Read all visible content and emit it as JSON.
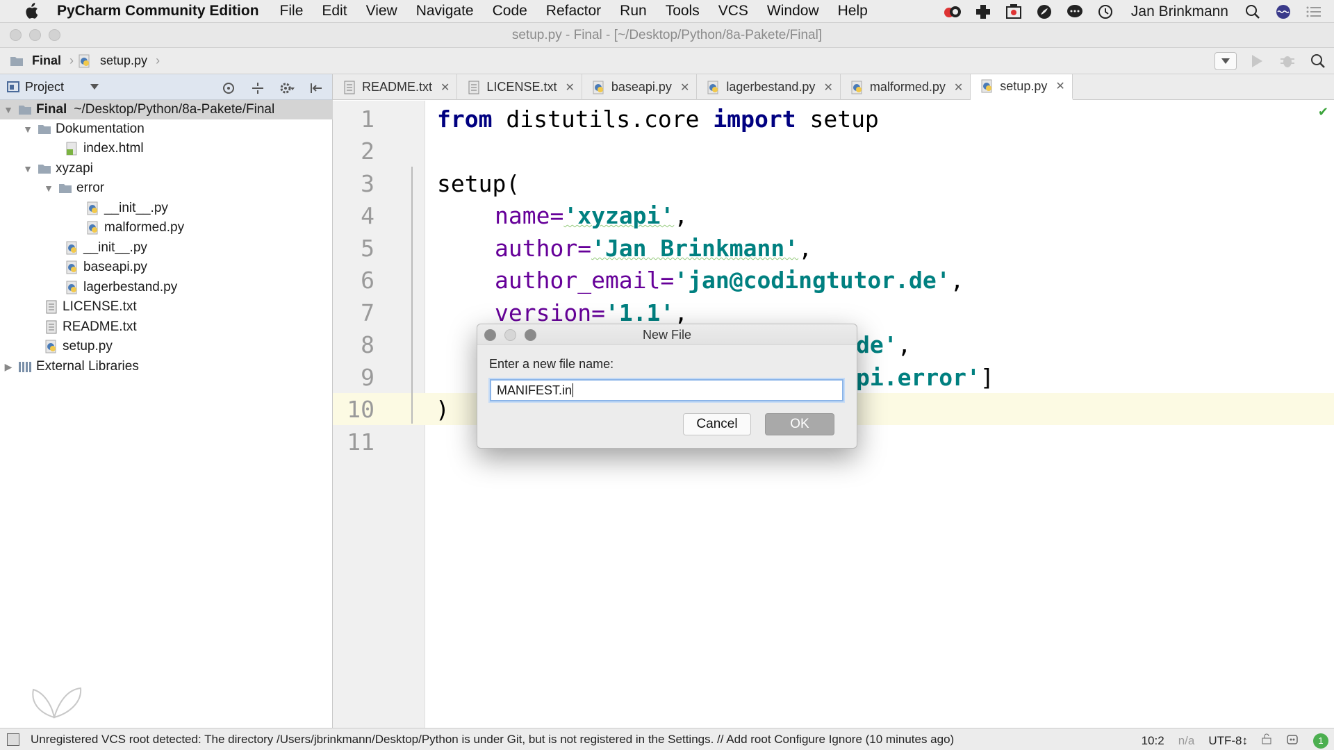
{
  "menubar": {
    "app_name": "PyCharm Community Edition",
    "items": [
      "File",
      "Edit",
      "View",
      "Navigate",
      "Code",
      "Refactor",
      "Run",
      "Tools",
      "VCS",
      "Window",
      "Help"
    ],
    "user": "Jan Brinkmann"
  },
  "window": {
    "title": "setup.py - Final - [~/Desktop/Python/8a-Pakete/Final]"
  },
  "breadcrumb": {
    "root": "Final",
    "file": "setup.py"
  },
  "project_panel": {
    "title": "Project",
    "tree": [
      {
        "name": "Final",
        "detail": "~/Desktop/Python/8a-Pakete/Final",
        "type": "folder"
      },
      {
        "name": "Dokumentation",
        "type": "folder"
      },
      {
        "name": "index.html",
        "type": "html"
      },
      {
        "name": "xyzapi",
        "type": "folder"
      },
      {
        "name": "error",
        "type": "folder"
      },
      {
        "name": "__init__.py",
        "type": "py"
      },
      {
        "name": "malformed.py",
        "type": "py"
      },
      {
        "name": "__init__.py",
        "type": "py"
      },
      {
        "name": "baseapi.py",
        "type": "py"
      },
      {
        "name": "lagerbestand.py",
        "type": "py"
      },
      {
        "name": "LICENSE.txt",
        "type": "txt"
      },
      {
        "name": "README.txt",
        "type": "txt"
      },
      {
        "name": "setup.py",
        "type": "py"
      },
      {
        "name": "External Libraries",
        "type": "lib"
      }
    ]
  },
  "tabs": [
    {
      "label": "README.txt",
      "type": "txt"
    },
    {
      "label": "LICENSE.txt",
      "type": "txt"
    },
    {
      "label": "baseapi.py",
      "type": "py"
    },
    {
      "label": "lagerbestand.py",
      "type": "py"
    },
    {
      "label": "malformed.py",
      "type": "py"
    },
    {
      "label": "setup.py",
      "type": "py",
      "active": true
    }
  ],
  "editor": {
    "line_numbers": [
      "1",
      "2",
      "3",
      "4",
      "5",
      "6",
      "7",
      "8",
      "9",
      "10",
      "11"
    ],
    "current_line": "10",
    "code": {
      "l1_from": "from",
      "l1_mod": " distutils.core ",
      "l1_import": "import",
      "l1_name": " setup",
      "l3": "setup(",
      "l4_key": "name=",
      "l4_val": "'xyzapi'",
      "l4_end": ",",
      "l5_key": "author=",
      "l5_val": "'Jan Brinkmann'",
      "l5_end": ",",
      "l6_key": "author_email=",
      "l6_val": "'jan@codingtutor.de'",
      "l6_end": ",",
      "l7_key": "version=",
      "l7_val": "'1.1'",
      "l7_end": ",",
      "l8_val": "de'",
      "l8_end": ",",
      "l9_val": "pi.error'",
      "l9_end": "]",
      "l10": ")"
    }
  },
  "dialog": {
    "title": "New File",
    "prompt": "Enter a new file name:",
    "input_value": "MANIFEST.in",
    "cancel_label": "Cancel",
    "ok_label": "OK"
  },
  "statusbar": {
    "message": "Unregistered VCS root detected: The directory /Users/jbrinkmann/Desktop/Python is under Git, but is not registered in the Settings. // Add root  Configure  Ignore (10 minutes ago)",
    "position": "10:2",
    "na": "n/a",
    "encoding": "UTF-8↕",
    "badge": "1"
  },
  "colors": {
    "keyword": "#000080",
    "string": "#008080",
    "param": "#660099",
    "current_line": "#fcfae3",
    "selection": "#d4d4d4"
  }
}
